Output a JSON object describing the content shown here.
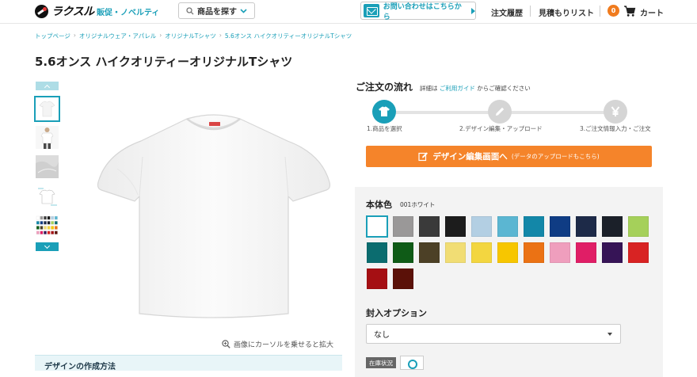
{
  "header": {
    "logo_text": "ラクスル",
    "promo_link": "販促・ノベルティ",
    "search_label": "商品を探す",
    "contact_label": "お問い合わせはこちらから",
    "order_history": "注文履歴",
    "estimate_list": "見積もりリスト",
    "cart_count": "0",
    "cart_label": "カート"
  },
  "breadcrumb": [
    "トップページ",
    "オリジナルウェア・アパレル",
    "オリジナルTシャツ",
    "5.6オンス ハイクオリティーオリジナルTシャツ"
  ],
  "product": {
    "title": "5.6オンス ハイクオリティーオリジナルTシャツ",
    "zoom_hint": "画像にカーソルを乗せると拡大",
    "howto_title": "デザインの作成方法"
  },
  "flow": {
    "title": "ご注文の流れ",
    "note_prefix": "詳細は",
    "note_link": "ご利用ガイド",
    "note_suffix": "からご確認ください",
    "steps": [
      "1.商品を選択",
      "2.デザイン編集・アップロード",
      "3.ご注文情報入力・ご注文"
    ],
    "step_icons": [
      "tshirt-icon",
      "pencil-icon",
      "yen-icon"
    ],
    "accent": "#1a9fb8"
  },
  "design_button": {
    "label": "デザイン編集画面へ",
    "sub": "(データのアップロードもこちら)",
    "color": "#f5842a"
  },
  "colors": {
    "label": "本体色",
    "selected_name": "001ホワイト",
    "swatches": [
      "#ffffff",
      "#9a9898",
      "#3a3a3a",
      "#1c1c1c",
      "#b3cfe3",
      "#5bb6d2",
      "#1387a8",
      "#0f3c84",
      "#1d2a48",
      "#1b2029",
      "#a5d05a",
      "#0b6c6f",
      "#0f5b17",
      "#4c4026",
      "#f1dd74",
      "#f3d640",
      "#f7c600",
      "#eb7214",
      "#ef9ebd",
      "#e01e66",
      "#361456",
      "#d82323",
      "#a50f13",
      "#5b1108"
    ]
  },
  "options": {
    "label": "封入オプション",
    "selected": "なし"
  },
  "stock": {
    "label": "在庫状況"
  }
}
